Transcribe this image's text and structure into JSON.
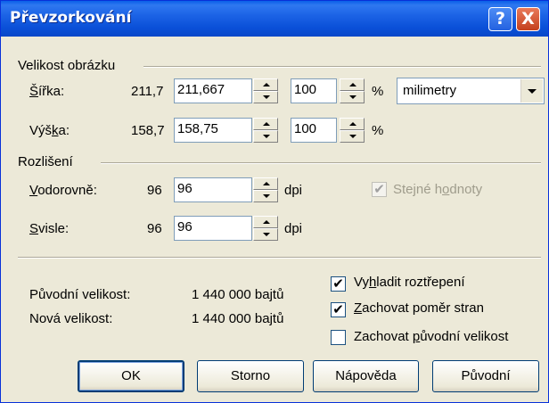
{
  "window": {
    "title": "Převzorkování"
  },
  "titlebar_buttons": {
    "help": "?",
    "close": "X"
  },
  "image_size": {
    "group_title": "Velikost obrázku",
    "width": {
      "label": "Šířka:",
      "current": "211,7",
      "value": "211,667",
      "percent": "100",
      "percent_sign": "%"
    },
    "height": {
      "label": "Výška:",
      "current": "158,7",
      "value": "158,75",
      "percent": "100",
      "percent_sign": "%"
    },
    "units": {
      "selected": "milimetry"
    }
  },
  "resolution": {
    "group_title": "Rozlišení",
    "horizontal": {
      "label": "Vodorovně:",
      "current": "96",
      "value": "96",
      "unit": "dpi"
    },
    "vertical": {
      "label": "Svisle:",
      "current": "96",
      "value": "96",
      "unit": "dpi"
    },
    "same_values": {
      "label": "Stejné hodnoty",
      "checked": true,
      "enabled": false
    }
  },
  "info": {
    "original_label": "Původní velikost:",
    "original_value": "1 440 000 bajtů",
    "new_label": "Nová velikost:",
    "new_value": "1 440 000 bajtů"
  },
  "options": [
    {
      "label": "Vyhladit roztřepení",
      "checked": true
    },
    {
      "label": "Zachovat poměr stran",
      "checked": true
    },
    {
      "label": "Zachovat původní velikost",
      "checked": false
    }
  ],
  "check_mark": "✔",
  "buttons": {
    "ok": "OK",
    "cancel": "Storno",
    "help": "Nápověda",
    "original": "Původní"
  }
}
